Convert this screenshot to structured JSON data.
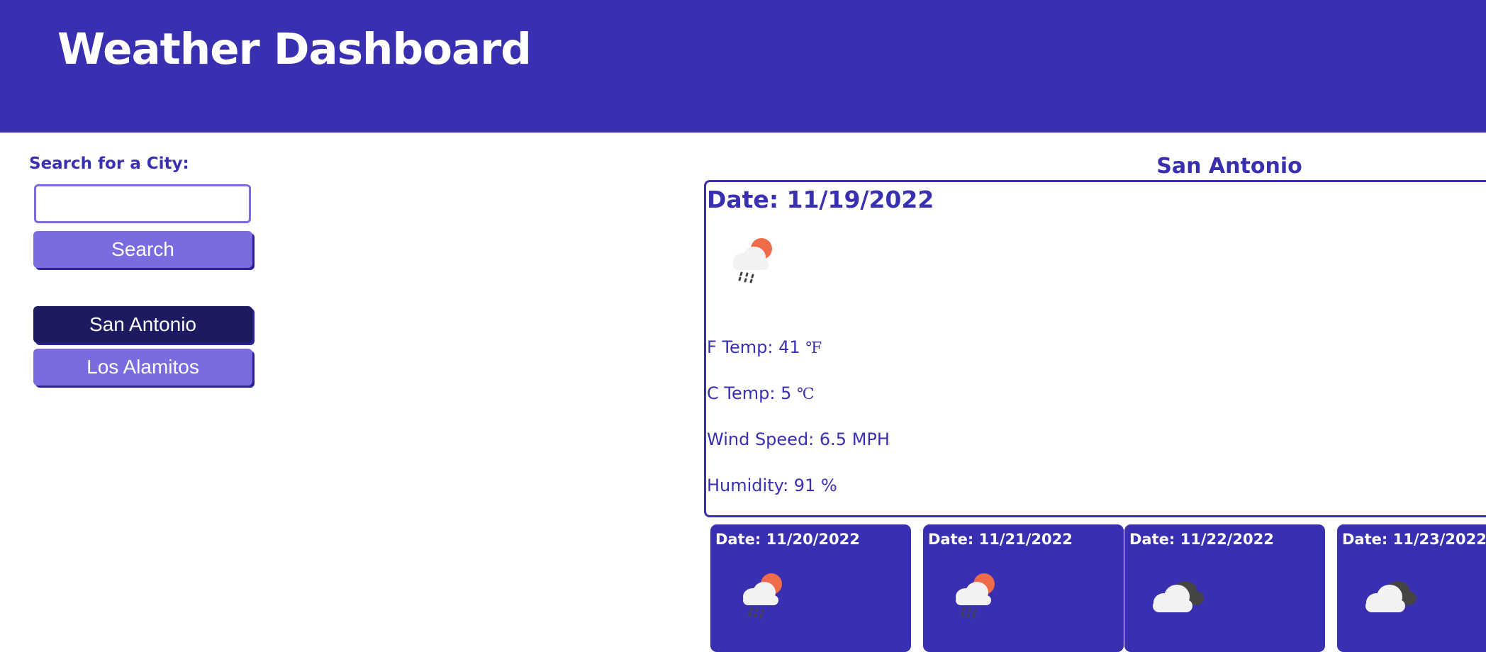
{
  "header": {
    "title": "Weather Dashboard"
  },
  "search": {
    "label": "Search for a City:",
    "input_value": "",
    "placeholder": "",
    "button_label": "Search"
  },
  "history": {
    "items": [
      {
        "label": "San Antonio"
      },
      {
        "label": "Los Alamitos"
      }
    ]
  },
  "current": {
    "city": "San Antonio",
    "date": "Date: 11/19/2022",
    "icon": "rain-sun-icon",
    "temp_f_label": "F Temp: 41",
    "temp_f_unit": "℉",
    "temp_c_label": "C Temp: 5",
    "temp_c_unit": "℃",
    "wind": "Wind Speed: 6.5 MPH",
    "humidity": "Humidity: 91 %"
  },
  "forecast": [
    {
      "date": "Date: 11/20/2022",
      "icon": "rain-sun-icon"
    },
    {
      "date": "Date: 11/21/2022",
      "icon": "rain-sun-icon"
    },
    {
      "date": "Date: 11/22/2022",
      "icon": "clouds-icon"
    },
    {
      "date": "Date: 11/23/2022",
      "icon": "clouds-icon"
    }
  ],
  "colors": {
    "primary": "#3830b0",
    "button": "#7b6be0",
    "active_button": "#1c1a60",
    "sun": "#ef6b4a",
    "cloud": "#f2f2f2",
    "dark_cloud": "#444444"
  }
}
